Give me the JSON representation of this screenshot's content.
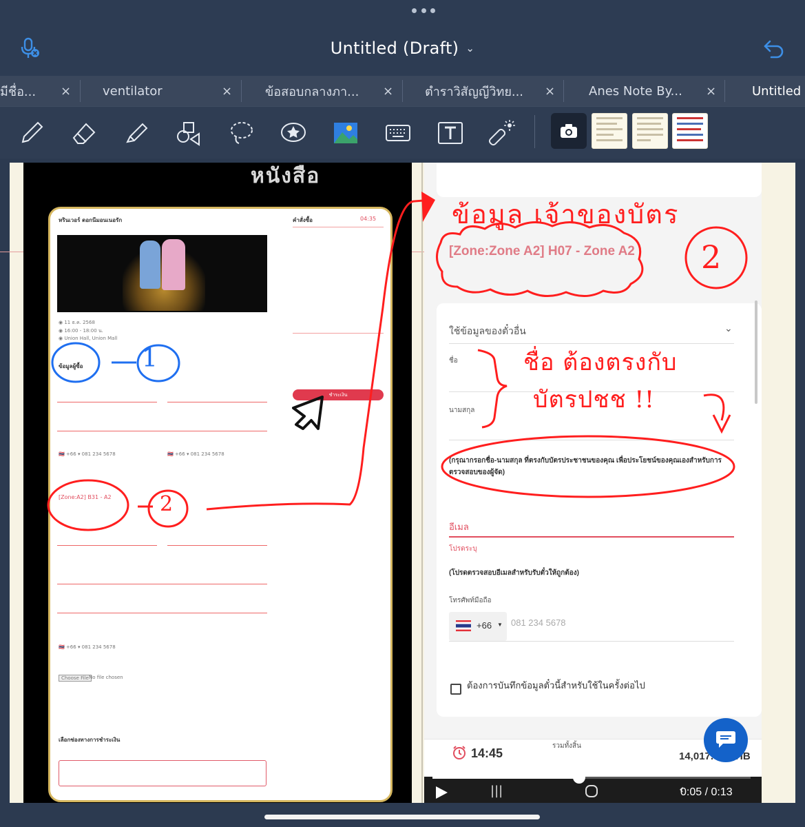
{
  "header": {
    "title": "Untitled (Draft)",
    "title_caret": "⌄"
  },
  "tabs": [
    {
      "label": "มีชื่อ..."
    },
    {
      "label": "ventilator"
    },
    {
      "label": "ข้อสอบกลางภา..."
    },
    {
      "label": "ตำราวิสัญญีวิทย..."
    },
    {
      "label": "Anes Note By..."
    },
    {
      "label": "Untitled"
    }
  ],
  "tab_close": "×",
  "toolbar": {
    "tools": [
      "pen",
      "eraser",
      "highlighter",
      "shapes",
      "lasso",
      "sticker",
      "image",
      "keyboard",
      "text",
      "laser-pointer"
    ],
    "thumbnails": 3
  },
  "left_screenshot": {
    "header_text": "หนังสือ",
    "card_title": "หรินเวอร์ ดอกนีมอนเนอรัก",
    "countdown": "04:35",
    "order_title": "คำสั่งซื้อ",
    "buyer_section": "ข้อมูลผู้ซื้อ",
    "zone_label": "[Zone:A2] B31 - A2",
    "confirm_button": "ชำระเงิน",
    "payment_section": "เลือกช่องทางการชำระเงิน",
    "file_button": "Choose File",
    "file_status": "No file chosen"
  },
  "right_screenshot": {
    "zone_title": "[Zone:Zone A2] H07 - Zone A2",
    "use_other_info": "ใช้ข้อมูลของตั๋วอื่น",
    "first_name_label": "ชื่อ",
    "last_name_label": "นามสกุล",
    "name_note": "(กรุณากรอกชื่อ-นามสกุล ที่ตรงกับบัตรประชาชนของคุณ เพื่อประโยชน์ของคุณเองสำหรับการตรวจสอบของผู้จัด)",
    "email_label": "อีเมล",
    "email_required": "โปรดระบุ",
    "email_note": "(โปรดตรวจสอบอีเมลสำหรับรับตั๋วให้ถูกต้อง)",
    "phone_label": "โทรศัพท์มือถือ",
    "phone_code": "+66",
    "phone_placeholder": "081 234 5678",
    "save_info": "ต้องการบันทึกข้อมูลตั๋วนี้สำหรับใช้ในครั้งต่อไป",
    "timer": "14:45",
    "total_label": "รวมทั้งสิ้น",
    "total_value": "14,017.",
    "total_suffix": "HB",
    "video_time": "0:05 / 0:13"
  },
  "annotations": {
    "owner_heading": "ข้อมูล เจ้าของบัตร",
    "circle_1": "1",
    "circle_2a": "2",
    "circle_2b": "2",
    "name_check": "ชื่อ ต้องตรงกับ",
    "name_check_2": "บัตรปชช !!"
  }
}
